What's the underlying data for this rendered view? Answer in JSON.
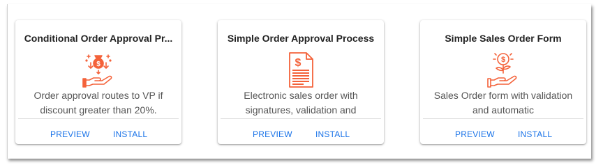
{
  "cards": [
    {
      "title": "Conditional Order Approval Pr...",
      "description": "Order approval routes to VP if discount greater than 20%.",
      "icon": "money-bag-hand-icon",
      "preview_label": "PREVIEW",
      "install_label": "INSTALL"
    },
    {
      "title": "Simple Order Approval Process",
      "description": "Electronic sales order with signatures, validation and",
      "icon": "dollar-document-icon",
      "preview_label": "PREVIEW",
      "install_label": "INSTALL"
    },
    {
      "title": "Simple Sales Order Form",
      "description": "Sales Order form with validation and automatic",
      "icon": "dollar-plant-hand-icon",
      "preview_label": "PREVIEW",
      "install_label": "INSTALL"
    }
  ],
  "colors": {
    "icon_accent": "#f4623a",
    "action_link": "#1a73e8"
  }
}
